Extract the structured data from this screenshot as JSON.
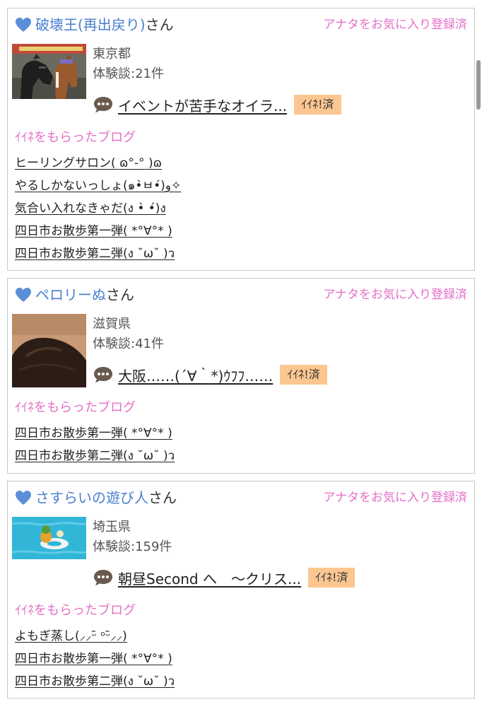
{
  "fav_status": "アナタをお気に入り登録済",
  "san_suffix": "さん",
  "iine_badge": "ｲｲﾈ!済",
  "blogs_heading": "ｲｲﾈをもらったブログ",
  "colors": {
    "name": "#4a7fcf",
    "pink": "#e56fc8",
    "badge": "#fbc690",
    "heart": "#5b8ed8"
  },
  "users": [
    {
      "name": "破壊王(再出戻り)",
      "prefecture": "東京都",
      "experience": "体験談:21件",
      "latest_post": "イベントが苦手なオイラ...",
      "avatar_icon": "horses-photo",
      "blogs": [
        "ヒーリングサロン( ɷ°-° )ɷ",
        "やるしかないっしょ(๑•̀ㅂ•́)و✧",
        "気合い入れなきゃだ(ง •̀ •́)ง",
        "四日市お散歩第一弾( *°∀°* )",
        "四日市お散歩第二弾(ง ˘ω˘ )ว"
      ]
    },
    {
      "name": "ペロリーぬ",
      "prefecture": "滋賀県",
      "experience": "体験談:41件",
      "latest_post": "大阪……(´∀｀*)ｳﾌﾌ……",
      "avatar_icon": "hair-selfie-photo",
      "blogs": [
        "四日市お散歩第一弾( *°∀°* )",
        "四日市お散歩第二弾(ง ˘ω˘ )ว"
      ]
    },
    {
      "name": "さすらいの遊び人",
      "prefecture": "埼玉県",
      "experience": "体験談:159件",
      "latest_post": "朝昼Second へ　～クリス...",
      "avatar_icon": "pool-toy-photo",
      "blogs": [
        "よもぎ蒸し(⸝⸝ᵕ̄ ᵒᵕ̄⸝⸝)",
        "四日市お散歩第一弾( *°∀°* )",
        "四日市お散歩第二弾(ง ˘ω˘ )ว"
      ]
    }
  ]
}
